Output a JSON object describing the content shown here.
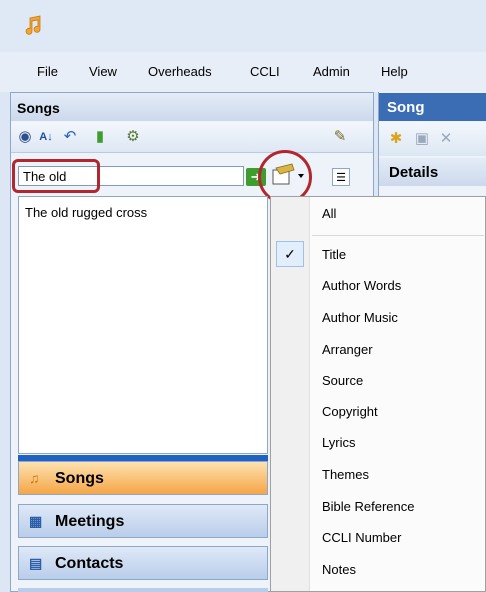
{
  "menubar": {
    "items": [
      "File",
      "View",
      "Overheads",
      "CCLI",
      "Admin",
      "Help"
    ]
  },
  "songs_panel": {
    "title": "Songs",
    "search": {
      "value": "The old",
      "placeholder": ""
    },
    "results": [
      "The old rugged cross"
    ]
  },
  "navigation": {
    "songs": "Songs",
    "meetings": "Meetings",
    "contacts": "Contacts"
  },
  "song_panel": {
    "title": "Song",
    "details": "Details"
  },
  "field_menu": {
    "items": [
      {
        "label": "All",
        "checked": false
      },
      {
        "label": "Title",
        "checked": true
      },
      {
        "label": "Author Words",
        "checked": false
      },
      {
        "label": "Author Music",
        "checked": false
      },
      {
        "label": "Arranger",
        "checked": false
      },
      {
        "label": "Source",
        "checked": false
      },
      {
        "label": "Copyright",
        "checked": false
      },
      {
        "label": "Lyrics",
        "checked": false
      },
      {
        "label": "Themes",
        "checked": false
      },
      {
        "label": "Bible Reference",
        "checked": false
      },
      {
        "label": "CCLI Number",
        "checked": false
      },
      {
        "label": "Notes",
        "checked": false
      }
    ]
  },
  "colors": {
    "highlight_red": "#b2262e",
    "accent_blue": "#3a6db3",
    "active_nav_orange": "#f5a647"
  },
  "icons": [
    "music-note-icon",
    "binoculars-icon",
    "sort-az-icon",
    "undo-icon",
    "book-icon",
    "filter-icon",
    "field-select-icon",
    "go-arrow-icon",
    "new-icon",
    "save-icon",
    "delete-icon",
    "checkmark-icon",
    "calendar-icon",
    "contact-card-icon"
  ]
}
